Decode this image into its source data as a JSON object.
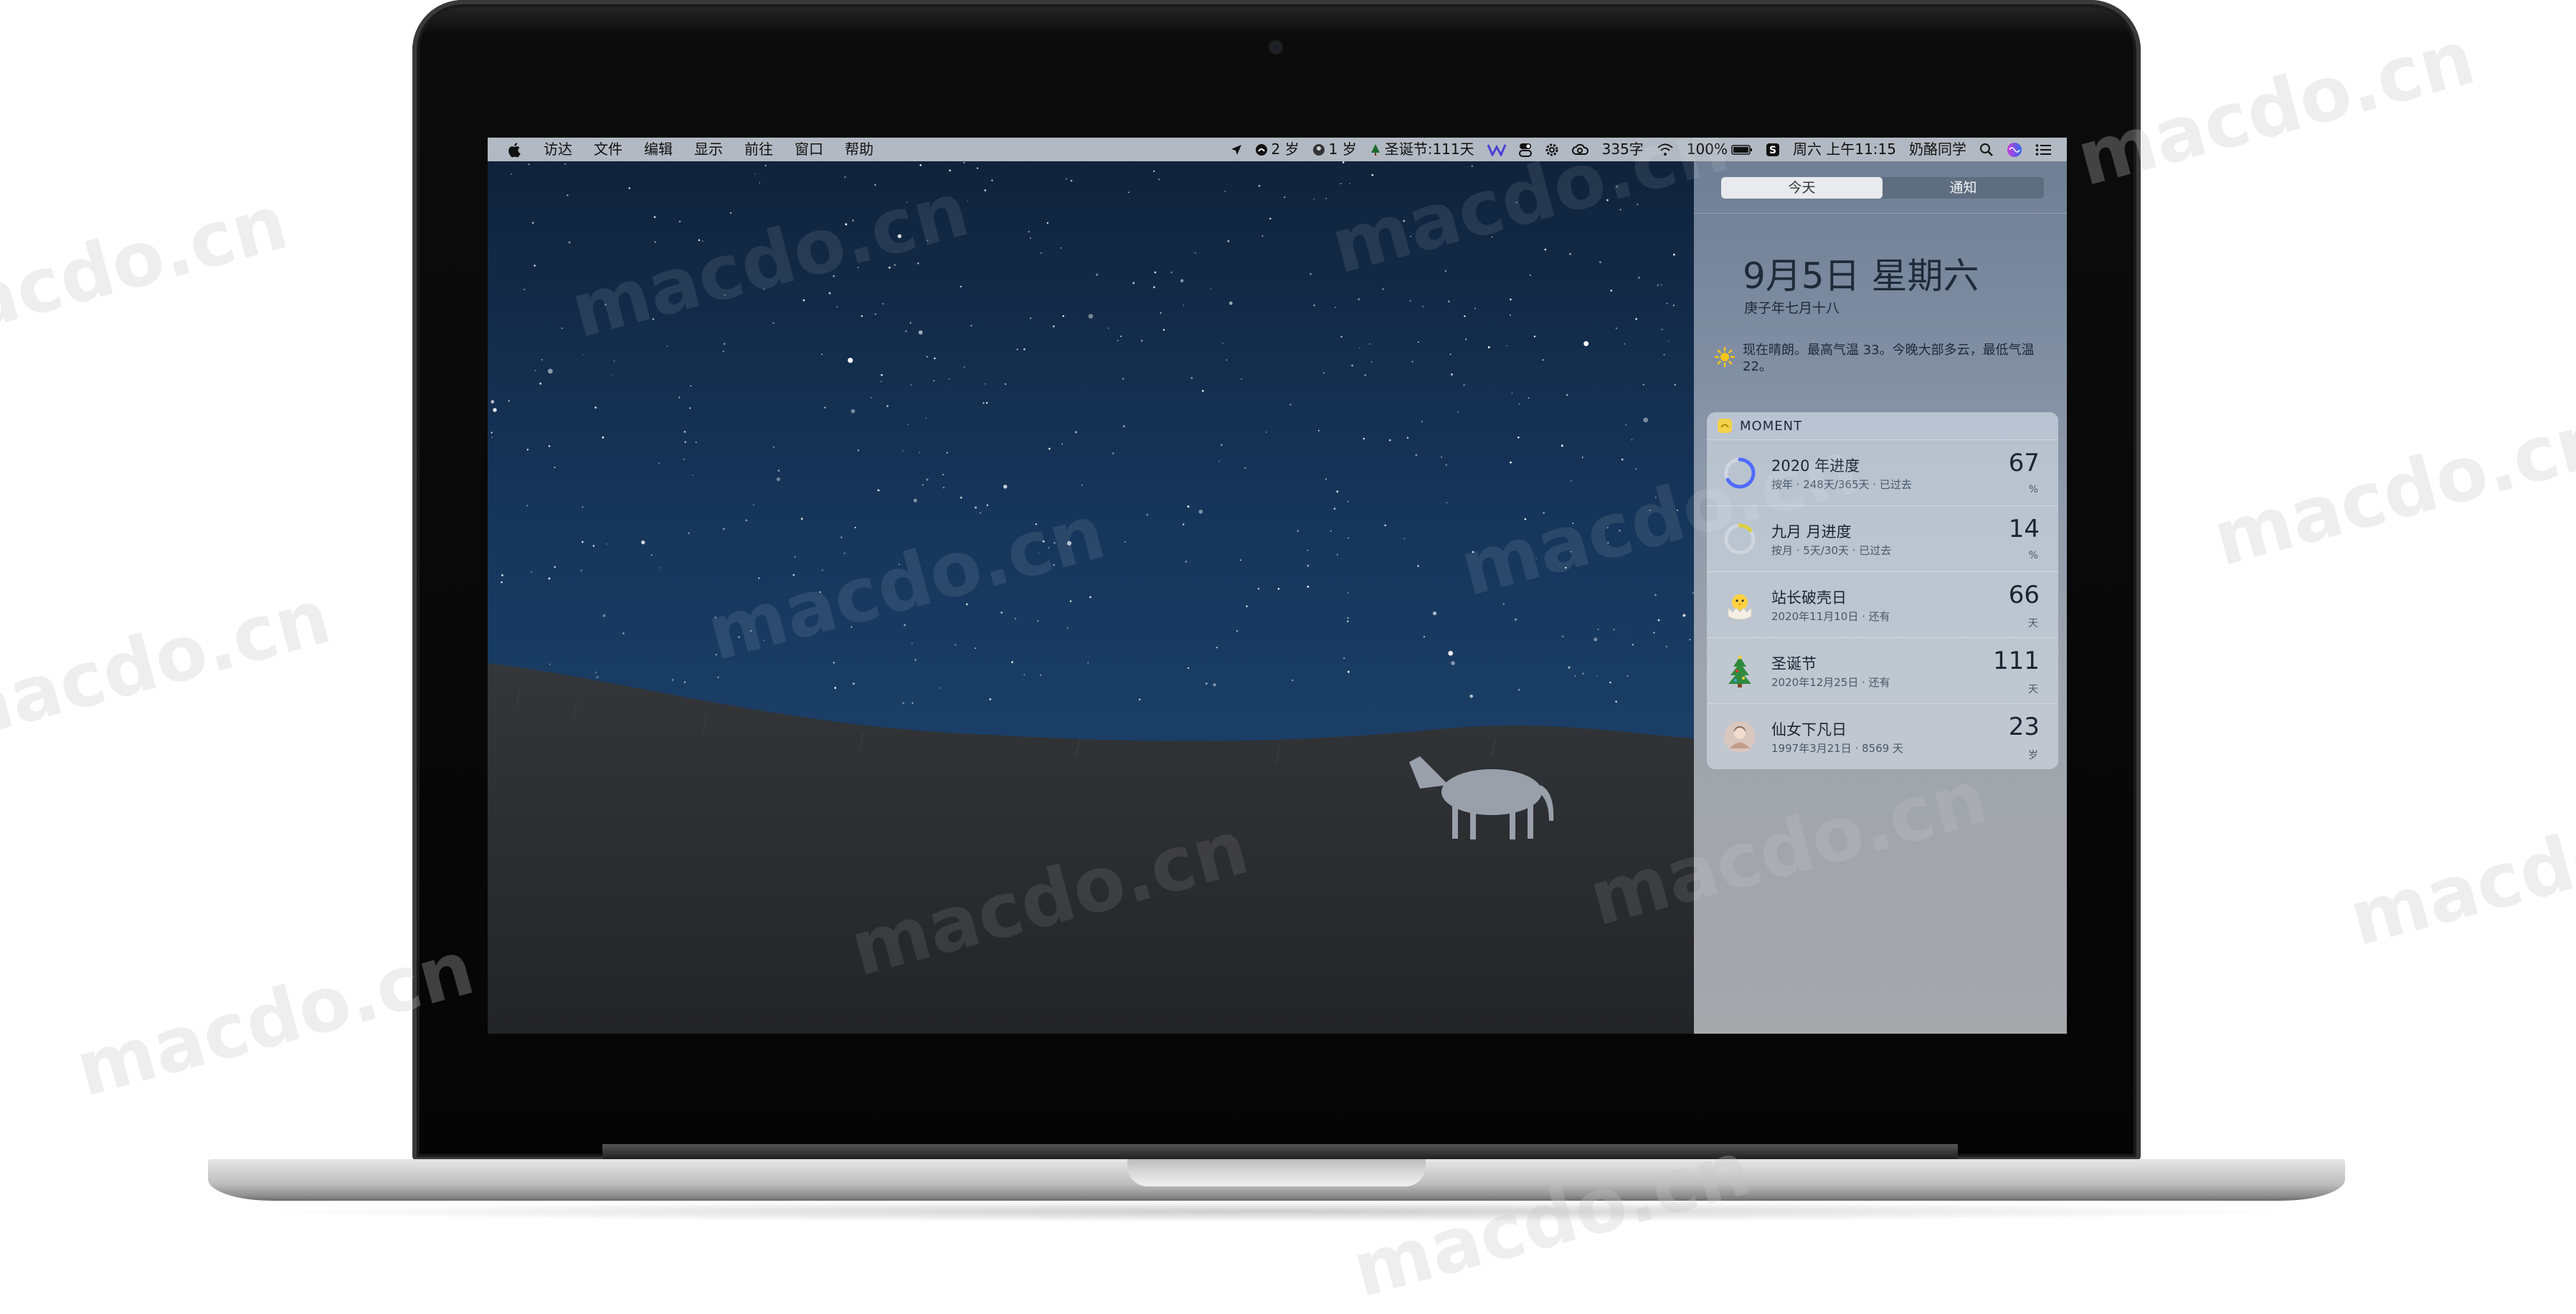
{
  "menubar": {
    "apple": "",
    "items": [
      "访达",
      "文件",
      "编辑",
      "显示",
      "前往",
      "窗口",
      "帮助"
    ],
    "status": {
      "age_a": "2 岁",
      "age_b": "1 岁",
      "christmas": "圣诞节:111天",
      "word_count": "335字",
      "battery": "100%",
      "datetime": "周六 上午11:15",
      "user": "奶酪同学"
    }
  },
  "notification_center": {
    "tabs": [
      "今天",
      "通知"
    ],
    "active_tab": 0,
    "date": "9月5日 星期六",
    "lunar": "庚子年七月十八",
    "weather": "现在晴朗。最高气温 33。今晚大部多云，最低气温 22。",
    "widget": {
      "title": "MOMENT",
      "items": [
        {
          "title": "2020 年进度",
          "subtitle": "按年 · 248天/365天 · 已过去",
          "value": "67",
          "unit": "%",
          "icon": "ring-progress-icon",
          "progress": 0.67
        },
        {
          "title": "九月 月进度",
          "subtitle": "按月 · 5天/30天 · 已过去",
          "value": "14",
          "unit": "%",
          "icon": "ring-progress-icon",
          "progress": 0.14
        },
        {
          "title": "站长破壳日",
          "subtitle": "2020年11月10日 · 还有",
          "value": "66",
          "unit": "天",
          "icon": "hatching-chick-icon"
        },
        {
          "title": "圣诞节",
          "subtitle": "2020年12月25日 · 还有",
          "value": "111",
          "unit": "天",
          "icon": "christmas-tree-icon"
        },
        {
          "title": "仙女下凡日",
          "subtitle": "1997年3月21日 · 8569 天",
          "value": "23",
          "unit": "岁",
          "icon": "avatar-icon"
        }
      ]
    }
  },
  "watermark": "macdo.cn",
  "colors": {
    "menubar": "#b3b9c2",
    "ring_blue": "#4f6bff",
    "ring_yellow": "#d9d040"
  }
}
